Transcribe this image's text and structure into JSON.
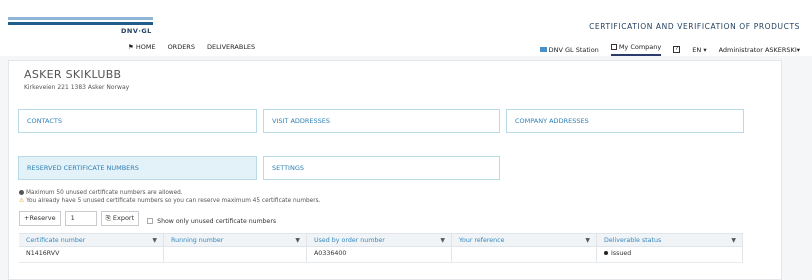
{
  "header": {
    "logo_text": "DNV·GL",
    "product_title": "CERTIFICATION AND VERIFICATION OF PRODUCTS"
  },
  "nav": {
    "home": "HOME",
    "orders": "ORDERS",
    "deliverables": "DELIVERABLES"
  },
  "right_nav": {
    "station": "DNV GL Station",
    "my_company": "My Company",
    "language": "EN",
    "user": "Administrator ASKERSKI"
  },
  "company": {
    "name": "ASKER SKIKLUBB",
    "address": "Kirkeveien 221  1383 Asker Norway"
  },
  "tiles": {
    "contacts": "CONTACTS",
    "visit_addresses": "VISIT ADDRESSES",
    "company_addresses": "COMPANY ADDRESSES",
    "reserved": "RESERVED CERTIFICATE NUMBERS",
    "settings": "SETTINGS"
  },
  "info": {
    "max_text": "Maximum 50 unused certificate numbers are allowed.",
    "warning_text": "You already have 5 unused certificate numbers so you can reserve maximum 45 certificate numbers."
  },
  "toolbar": {
    "reserve_label": "Reserve",
    "quantity": "1",
    "export_label": "Export",
    "show_unused_label": "Show only unused certificate numbers"
  },
  "table": {
    "columns": [
      "Certificate number",
      "Running number",
      "Used by order number",
      "Your reference",
      "Deliverable status"
    ],
    "rows": [
      [
        "N1416RVV",
        "",
        "A0336400",
        "",
        "Issued"
      ]
    ]
  },
  "colors": {
    "accent": "#2e7fb4",
    "tile_active_bg": "#e3f1f8",
    "brand_dark": "#1f5d8c"
  }
}
